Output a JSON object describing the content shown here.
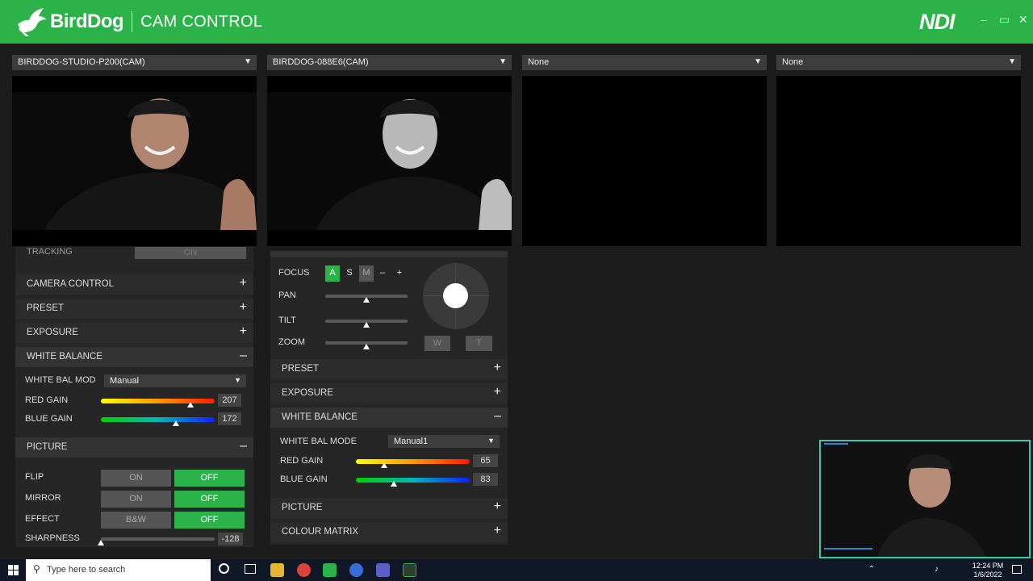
{
  "app": {
    "brand": "BirdDog",
    "name": "CAM CONTROL",
    "ndi": "NDI"
  },
  "window": {
    "minimize": "–",
    "restore": "▭",
    "close": "✕"
  },
  "sources": [
    {
      "label": "BIRDDOG-STUDIO-P200(CAM)"
    },
    {
      "label": "BIRDDOG-088E6(CAM)"
    },
    {
      "label": "None"
    },
    {
      "label": "None"
    }
  ],
  "left_panel": {
    "tracking_label": "TRACKING",
    "tracking_value": "ON",
    "sections": [
      {
        "label": "CAMERA CONTROL",
        "sign": "+"
      },
      {
        "label": "PRESET",
        "sign": "+"
      },
      {
        "label": "EXPOSURE",
        "sign": "+"
      },
      {
        "label": "WHITE BALANCE",
        "sign": "–"
      }
    ],
    "wb_mode_label": "WHITE BAL MOD",
    "wb_mode_value": "Manual",
    "red_gain_label": "RED GAIN",
    "red_gain_value": "207",
    "red_gain_level": 0.79,
    "blue_gain_label": "BLUE GAIN",
    "blue_gain_value": "172",
    "blue_gain_level": 0.66,
    "picture_label": "PICTURE",
    "picture_sign": "–",
    "flip_label": "FLIP",
    "mirror_label": "MIRROR",
    "effect_label": "EFFECT",
    "on": "ON",
    "off": "OFF",
    "bw": "B&W",
    "sharpness_label": "SHARPNESS",
    "sharpness_value": "-128",
    "sharpness_level": 0.0
  },
  "mid_panel": {
    "focus_label": "FOCUS",
    "focus_a": "A",
    "focus_s": "S",
    "focus_m": "M",
    "focus_minus": "–",
    "focus_plus": "+",
    "pan_label": "PAN",
    "pan_level": 0.5,
    "tilt_label": "TILT",
    "tilt_level": 0.5,
    "zoom_label": "ZOOM",
    "zoom_level": 0.5,
    "zoom_w": "W",
    "zoom_t": "T",
    "sections": [
      {
        "label": "PRESET",
        "sign": "+"
      },
      {
        "label": "EXPOSURE",
        "sign": "+"
      },
      {
        "label": "WHITE BALANCE",
        "sign": "–"
      }
    ],
    "wb_mode_label": "WHITE BAL MODE",
    "wb_mode_value": "Manual1",
    "red_gain_label": "RED GAIN",
    "red_gain_value": "65",
    "red_gain_level": 0.25,
    "blue_gain_label": "BLUE GAIN",
    "blue_gain_value": "83",
    "blue_gain_level": 0.33,
    "picture_label": "PICTURE",
    "picture_sign": "+",
    "colour_matrix_label": "COLOUR MATRIX",
    "colour_matrix_sign": "+"
  },
  "taskbar": {
    "search_placeholder": "Type here to search",
    "time": "12:24 PM",
    "date": "1/6/2022"
  },
  "colors": {
    "accent": "#2bb34a",
    "panel": "#262626",
    "background": "#1c1c1c"
  }
}
